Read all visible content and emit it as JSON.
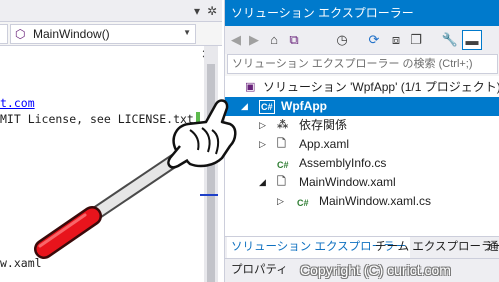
{
  "editor": {
    "toolbar": {
      "dropdown_arrow": "▾",
      "settings_icon": "gear-icon"
    },
    "member_dropdown": {
      "icon": "cube-icon",
      "value": "MainWindow()"
    },
    "split_icon": "split-icon",
    "code_lines": [
      {
        "text": "t.com",
        "style": "link"
      },
      {
        "text": "MIT License, see LICENSE.txt",
        "style": "text"
      },
      {
        "text": "w.xaml",
        "style": "text"
      }
    ]
  },
  "solution_explorer": {
    "title": "ソリューション エクスプローラー",
    "toolbar_icons": [
      "back-icon",
      "forward-icon",
      "home-icon",
      "vs-switch-icon",
      "history-icon",
      "refresh-icon",
      "collapse-all-icon",
      "copy-icon",
      "properties-icon",
      "pin-icon"
    ],
    "search_placeholder": "ソリューション エクスプローラー の検索 (Ctrl+;)",
    "tree": [
      {
        "label": "ソリューション 'WpfApp' (1/1 プロジェクト)",
        "icon": "solution-icon",
        "expander": "",
        "depth": 0,
        "selected": false
      },
      {
        "label": "WpfApp",
        "icon": "csharp-project-icon",
        "expander": "◢",
        "depth": 1,
        "selected": true
      },
      {
        "label": "依存関係",
        "icon": "dependencies-icon",
        "expander": "▷",
        "depth": 2,
        "selected": false
      },
      {
        "label": "App.xaml",
        "icon": "xaml-file-icon",
        "expander": "▷",
        "depth": 2,
        "selected": false
      },
      {
        "label": "AssemblyInfo.cs",
        "icon": "csharp-file-icon",
        "expander": "",
        "depth": 2,
        "selected": false
      },
      {
        "label": "MainWindow.xaml",
        "icon": "xaml-file-icon",
        "expander": "◢",
        "depth": 2,
        "selected": false
      },
      {
        "label": "MainWindow.xaml.cs",
        "icon": "csharp-file-icon",
        "expander": "▷",
        "depth": 3,
        "selected": false
      }
    ],
    "tabs": [
      {
        "label": "ソリューション エクスプローラー",
        "active": true
      },
      {
        "label": "チーム エクスプローラー",
        "active": false
      },
      {
        "label": "通",
        "active": false
      }
    ],
    "properties_label": "プロパティ"
  },
  "watermark": "Copyright (C) curict.com",
  "colors": {
    "accent": "#007acc",
    "selection": "#007acc",
    "pointer_red": "#e8141c"
  }
}
